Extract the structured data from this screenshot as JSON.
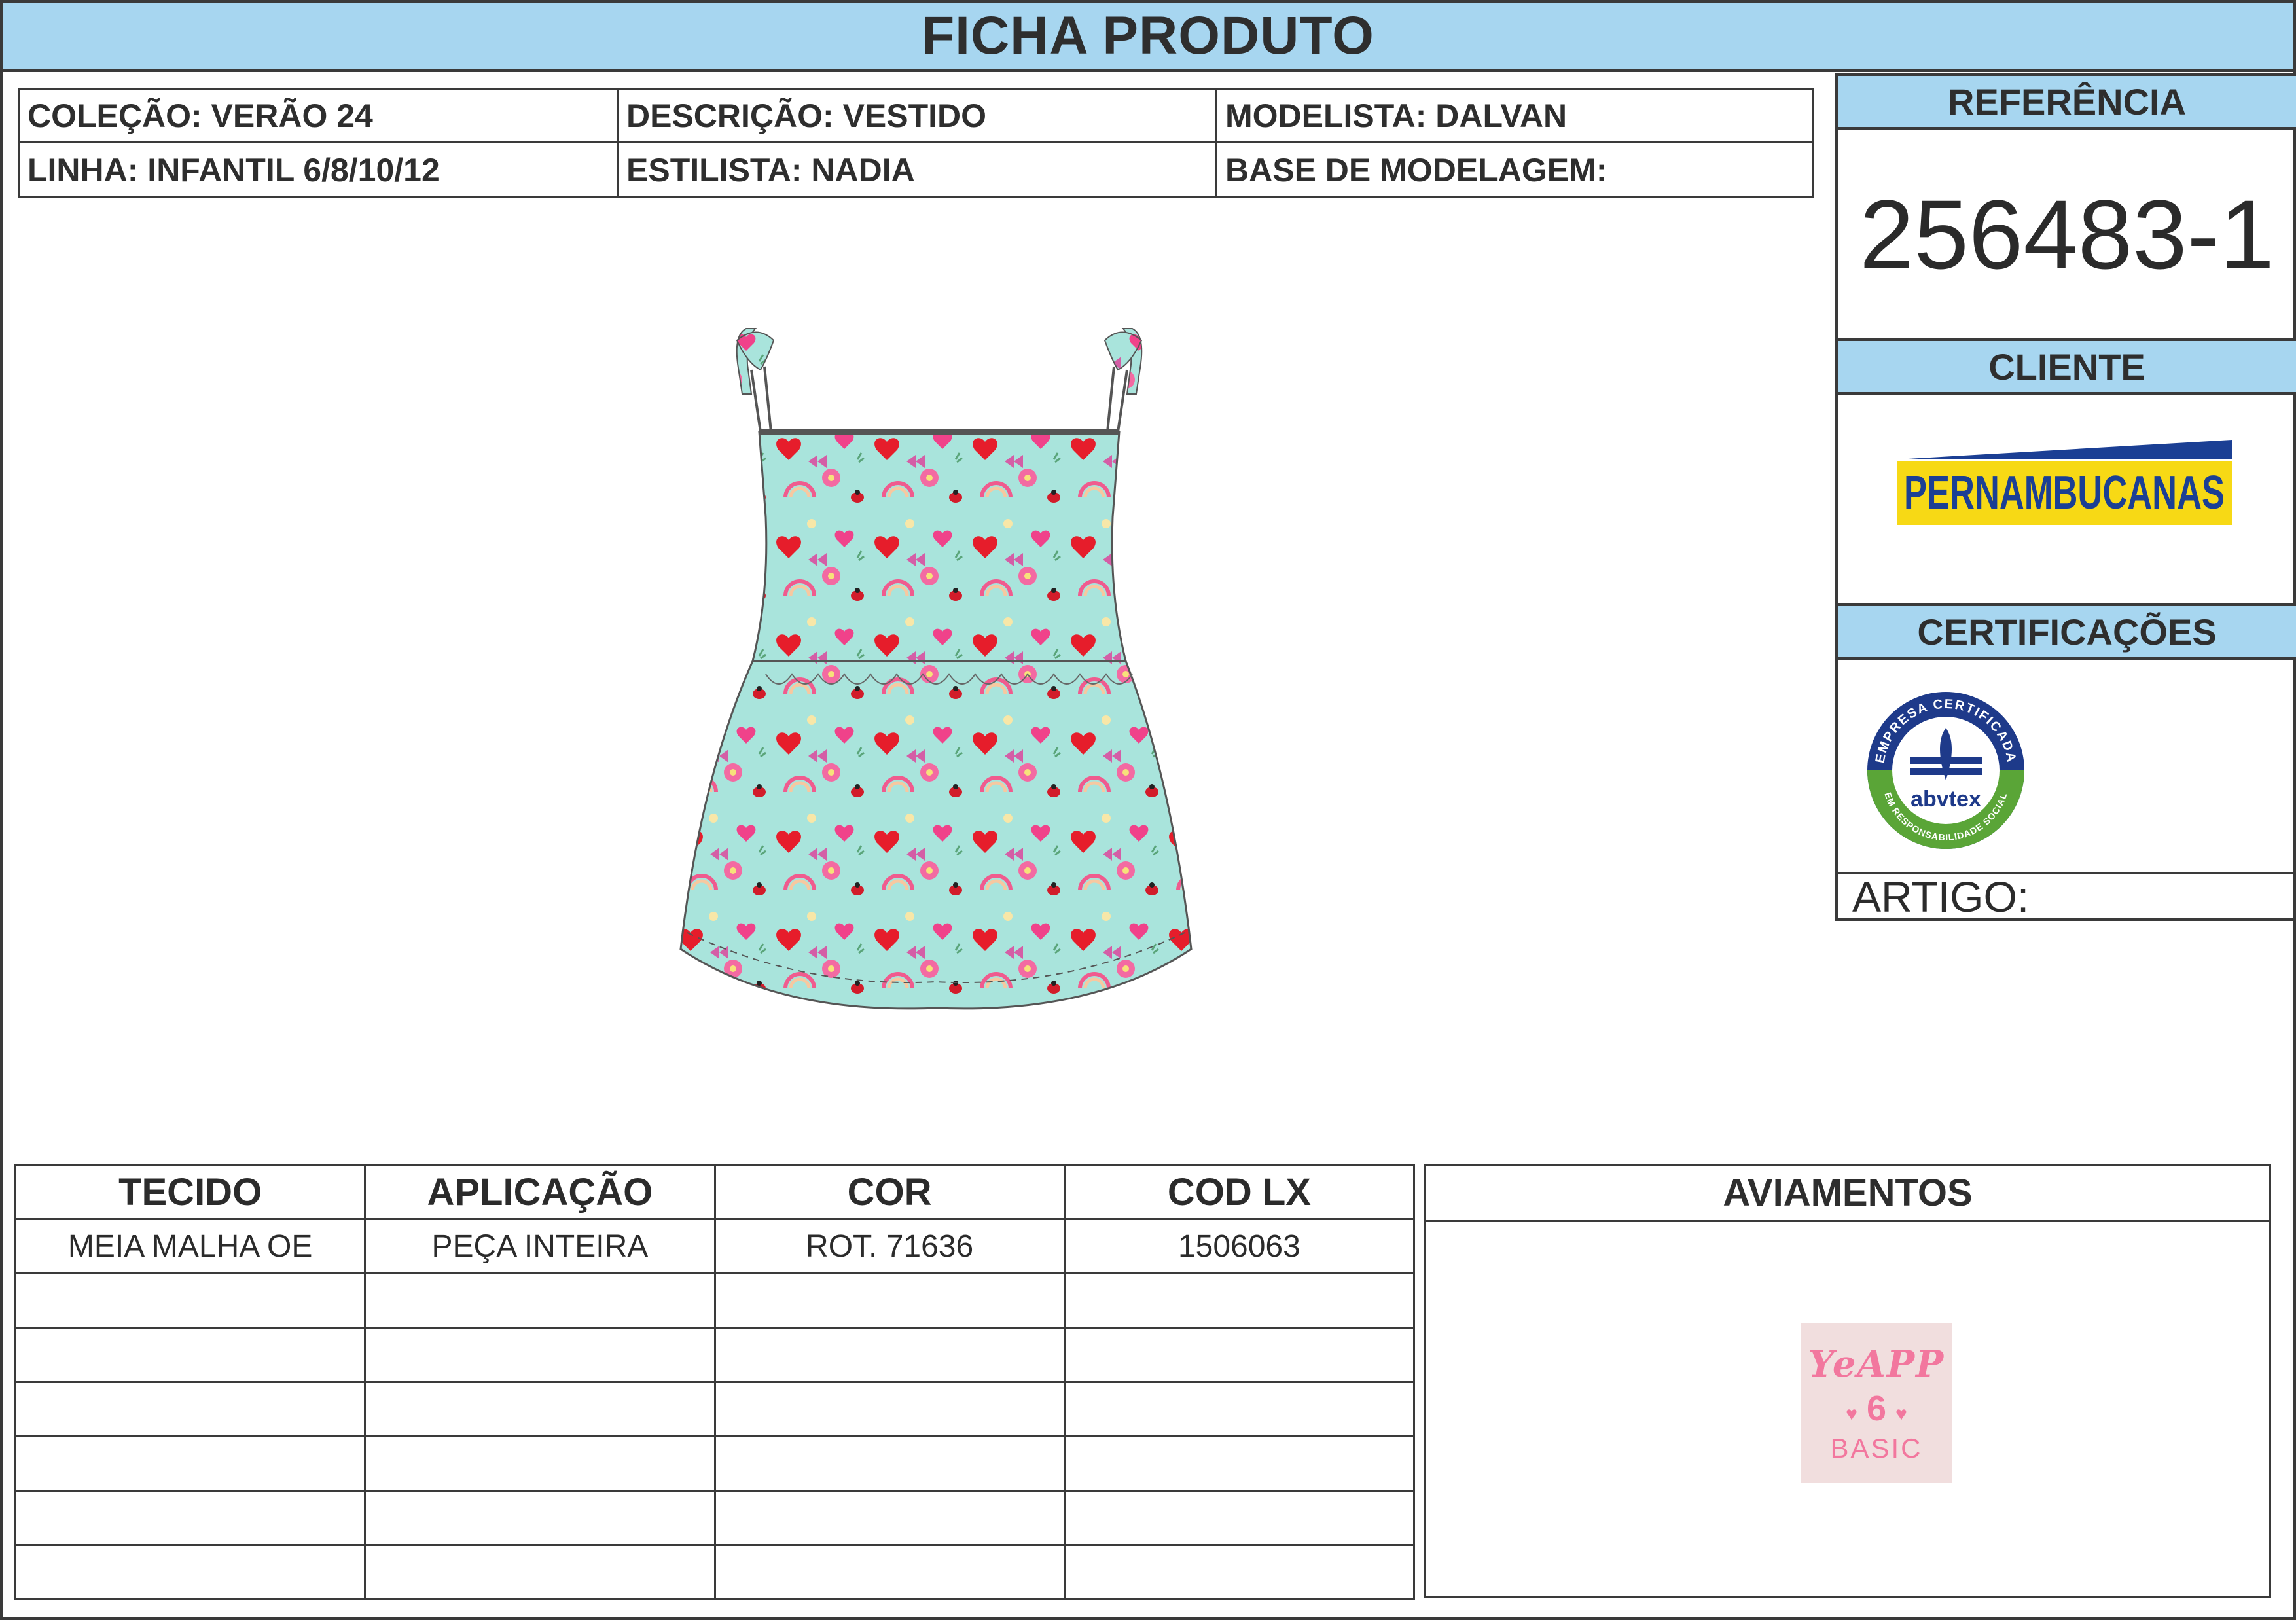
{
  "header": {
    "title": "FICHA PRODUTO"
  },
  "info": {
    "colecao": "COLEÇÃO: VERÃO 24",
    "descricao": "DESCRIÇÃO: VESTIDO",
    "modelista": "MODELISTA: DALVAN",
    "linha": "LINHA: INFANTIL 6/8/10/12",
    "estilista": "ESTILISTA:  NADIA",
    "base": "BASE DE MODELAGEM:"
  },
  "side": {
    "referencia_label": "REFERÊNCIA",
    "referencia_value": "256483-1",
    "cliente_label": "CLIENTE",
    "cliente_logo": "PERNAMBUCANAS",
    "certificacoes_label": "CERTIFICAÇÕES",
    "cert_badge": {
      "top": "EMPRESA CERTIFICADA",
      "brand": "abvtex",
      "bottom": "EM RESPONSABILIDADE SOCIAL"
    },
    "artigo_label": "ARTIGO:"
  },
  "fabric_table": {
    "headers": [
      "TECIDO",
      "APLICAÇÃO",
      "COR",
      "COD LX"
    ],
    "rows": [
      [
        "MEIA MALHA OE",
        "PEÇA INTEIRA",
        "ROT. 71636",
        "1506063"
      ],
      [
        "",
        "",
        "",
        ""
      ],
      [
        "",
        "",
        "",
        ""
      ],
      [
        "",
        "",
        "",
        ""
      ],
      [
        "",
        "",
        "",
        ""
      ],
      [
        "",
        "",
        "",
        ""
      ],
      [
        "",
        "",
        "",
        ""
      ]
    ]
  },
  "aviamentos": {
    "label": "AVIAMENTOS",
    "tag": {
      "line1": "YeAPP",
      "line2": "6",
      "line3": "BASIC"
    }
  },
  "colors": {
    "header_blue": "#a7d6f0",
    "border": "#3a3a3a",
    "dress_base": "#a9e4dc",
    "pern_yellow": "#f7d915",
    "pern_blue": "#1b3f94",
    "tag_pink": "#f2779e"
  }
}
